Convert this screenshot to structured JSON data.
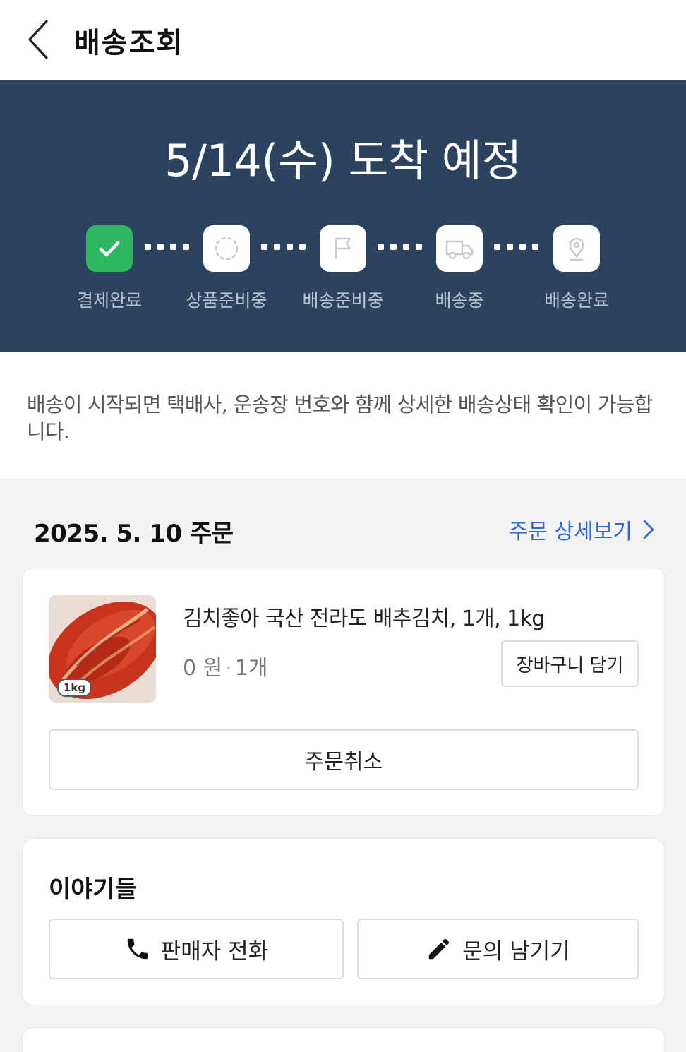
{
  "header": {
    "title": "배송조회"
  },
  "status": {
    "eta": "5/14(수) 도착 예정",
    "steps": [
      {
        "label": "결제완료",
        "icon": "check-icon",
        "done": true
      },
      {
        "label": "상품준비중",
        "icon": "loading-circle-icon",
        "done": false
      },
      {
        "label": "배송준비중",
        "icon": "flag-icon",
        "done": false
      },
      {
        "label": "배송중",
        "icon": "truck-icon",
        "done": false
      },
      {
        "label": "배송완료",
        "icon": "location-pin-icon",
        "done": false
      }
    ],
    "colors": {
      "banner": "#2c435f",
      "done": "#2fb861"
    }
  },
  "info": {
    "message": "배송이 시작되면 택배사, 운송장 번호와 함께 상세한 배송상태 확인이 가능합니다."
  },
  "order": {
    "date": "2025. 5. 10 주문",
    "detail_link": "주문 상세보기",
    "product": {
      "name": "김치좋아 국산 전라도 배추김치, 1개, 1kg",
      "price": "0 원",
      "separator": "·",
      "quantity": "1개",
      "image_badge": "1kg"
    },
    "cart_button": "장바구니 담기",
    "cancel_button": "주문취소"
  },
  "stories": {
    "title": "이야기들",
    "call_button": "판매자 전화",
    "inquiry_button": "문의 남기기"
  }
}
